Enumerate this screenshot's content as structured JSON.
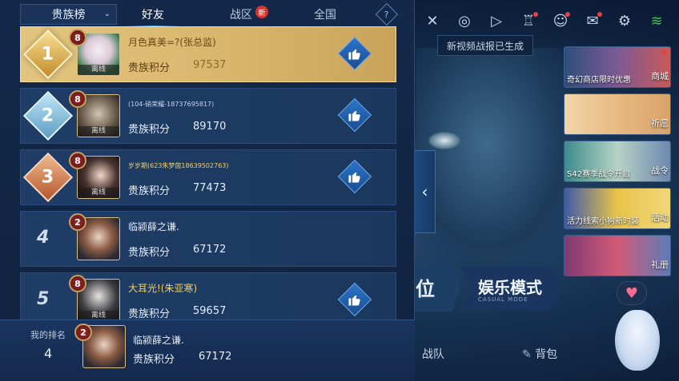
{
  "panel": {
    "dropdown_label": "贵族榜",
    "tabs": [
      {
        "label": "好友",
        "active": true
      },
      {
        "label": "战区",
        "badge": "新"
      },
      {
        "label": "全国"
      }
    ],
    "help": "?",
    "score_label": "贵族积分",
    "offline_label": "离线",
    "rows": [
      {
        "rank": "1",
        "level": "8",
        "name": "月色真美=?(张总监)",
        "score": "97537",
        "offline": true
      },
      {
        "rank": "2",
        "level": "8",
        "name": "(104-硝荣耀-18737695817)",
        "score": "89170",
        "offline": true
      },
      {
        "rank": "3",
        "level": "8",
        "name": "岁岁期(623朱梦茵18639502763)",
        "score": "77473",
        "offline": true
      },
      {
        "rank": "4",
        "level": "2",
        "name": "临颍薛之谦.",
        "score": "67172",
        "offline": false
      },
      {
        "rank": "5",
        "level": "8",
        "name": "大耳光!(朱亚寒)",
        "score": "59657",
        "offline": true
      }
    ],
    "my_rank": {
      "label": "我的排名",
      "rank": "4",
      "level": "2",
      "name": "临颍薛之谦.",
      "score": "67172"
    }
  },
  "right": {
    "tooltip": "新视频战报已生成",
    "promos": [
      {
        "caption": "奇幻商店限时优惠",
        "side": "商城"
      },
      {
        "caption": "",
        "side": "祈愿"
      },
      {
        "caption": "S42赛季战令开启",
        "side": "战令"
      },
      {
        "caption": "活力线索小狗新时装",
        "side": "活动"
      },
      {
        "caption": "",
        "side": "礼册"
      }
    ],
    "mode_rank": "位",
    "mode_casual": "娱乐模式",
    "mode_casual_sub": "CASUAL MODE",
    "bottom_tabs": [
      "战队",
      "背包"
    ]
  },
  "colors": {
    "gold_row": "#d7b46a",
    "row_blue": "#1f3d66",
    "accent": "#5fb3ff"
  }
}
